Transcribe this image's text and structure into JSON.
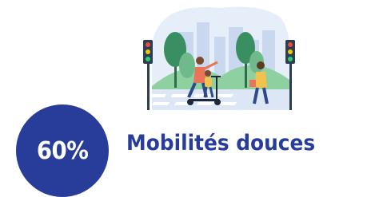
{
  "badge": {
    "text": "60%"
  },
  "title": {
    "text": "Mobilités douces"
  },
  "illustration": {
    "subject": "city-crosswalk-scene",
    "icons": [
      "traffic-light-icon",
      "tree-icon",
      "scooter-icon",
      "pedestrian-icon",
      "city-skyline-icon"
    ]
  },
  "colors": {
    "brand": "#283c9a",
    "sky": "#e6eef9",
    "skyline": "#c9d7ef",
    "tree": "#3a8f62",
    "tree_light": "#6fb98a",
    "hill": "#8fd0a0",
    "road": "#dde6f5",
    "crosswalk": "#ffffff",
    "traffic_light": "#2c3e50"
  }
}
